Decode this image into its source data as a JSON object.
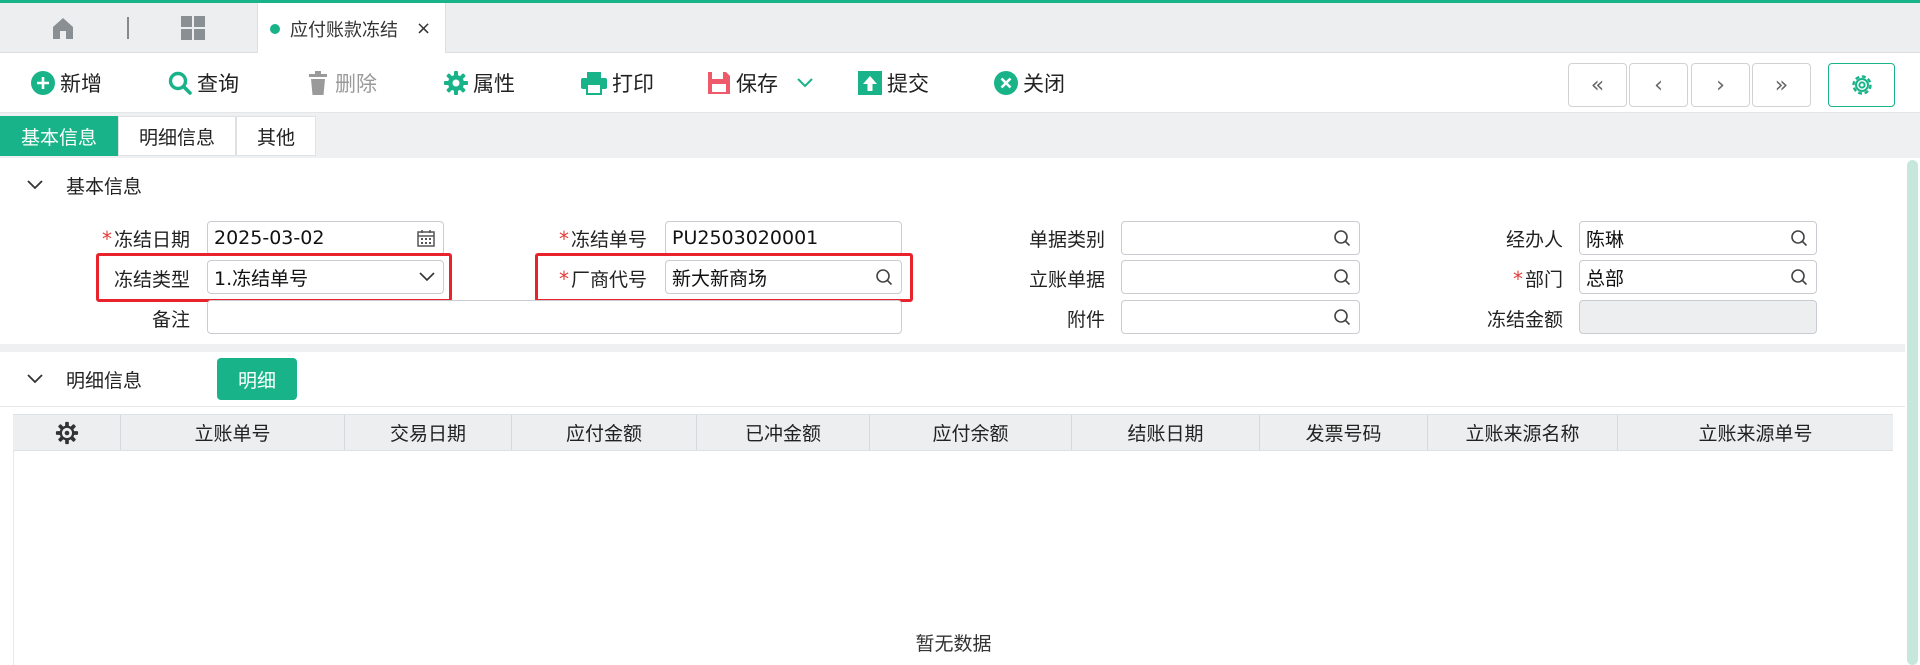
{
  "tabbar": {
    "active_tab": "应付账款冻结",
    "close_glyph": "×"
  },
  "toolbar": {
    "add": "新增",
    "query": "查询",
    "delete": "删除",
    "properties": "属性",
    "print": "打印",
    "save": "保存",
    "submit": "提交",
    "close": "关闭",
    "nav": [
      "«",
      "‹",
      "›",
      "»"
    ]
  },
  "section_tabs": [
    "基本信息",
    "明细信息",
    "其他"
  ],
  "basic": {
    "title": "基本信息",
    "freeze_date": {
      "label": "冻结日期",
      "value": "2025-03-02"
    },
    "freeze_no": {
      "label": "冻结单号",
      "value": "PU2503020001"
    },
    "doc_category": {
      "label": "单据类别",
      "value": ""
    },
    "handler": {
      "label": "经办人",
      "value": "陈琳"
    },
    "freeze_type": {
      "label": "冻结类型",
      "value": "1.冻结单号"
    },
    "vendor_code": {
      "label": "厂商代号",
      "value": "新大新商场"
    },
    "account_doc": {
      "label": "立账单据",
      "value": ""
    },
    "department": {
      "label": "部门",
      "value": "总部"
    },
    "remark": {
      "label": "备注",
      "value": ""
    },
    "attachment": {
      "label": "附件",
      "value": ""
    },
    "freeze_amount": {
      "label": "冻结金额",
      "value": ""
    },
    "required_mark": "*"
  },
  "detail": {
    "title": "明细信息",
    "button": "明细",
    "columns": [
      "立账单号",
      "交易日期",
      "应付金额",
      "已冲金额",
      "应付余额",
      "结账日期",
      "发票号码",
      "立账来源名称",
      "立账来源单号"
    ],
    "empty_text": "暂无数据"
  },
  "colors": {
    "accent": "#19b38a",
    "highlight": "#e8232b",
    "required": "#e23b3b"
  }
}
